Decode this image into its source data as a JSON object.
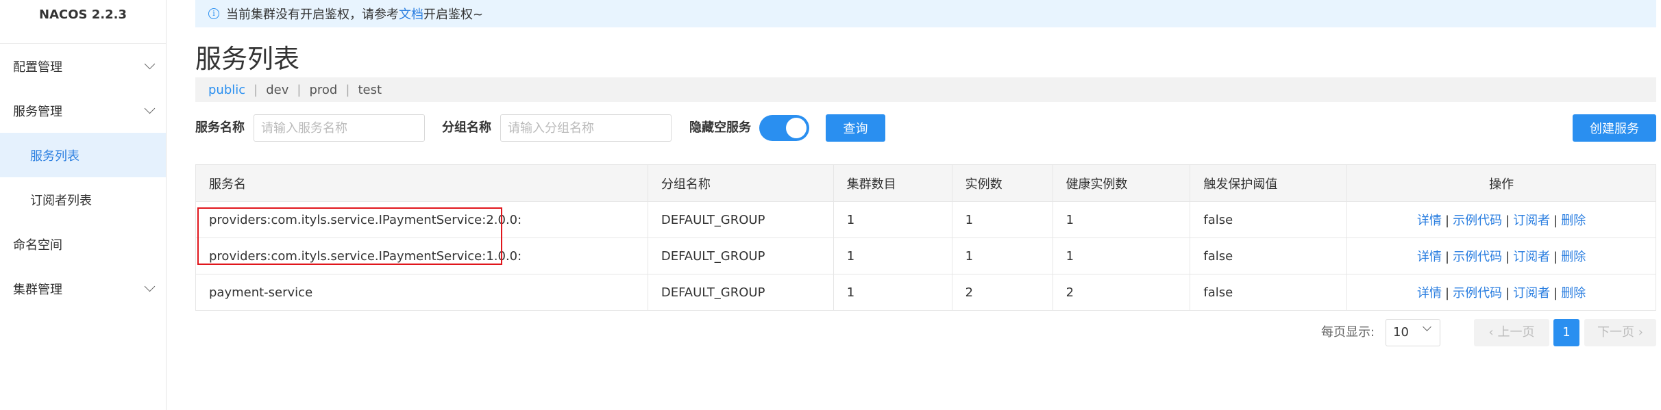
{
  "app": {
    "title": "NACOS 2.2.3"
  },
  "sidebar": {
    "items": [
      {
        "label": "配置管理"
      },
      {
        "label": "服务管理"
      },
      {
        "label": "服务列表"
      },
      {
        "label": "订阅者列表"
      },
      {
        "label": "命名空间"
      },
      {
        "label": "集群管理"
      }
    ]
  },
  "notice": {
    "text": "当前集群没有开启鉴权，请参考",
    "link": "文档",
    "suffix": "开启鉴权~"
  },
  "page": {
    "title": "服务列表"
  },
  "namespaces": [
    "public",
    "dev",
    "prod",
    "test"
  ],
  "filter": {
    "service_label": "服务名称",
    "service_placeholder": "请输入服务名称",
    "group_label": "分组名称",
    "group_placeholder": "请输入分组名称",
    "hide_empty_label": "隐藏空服务",
    "hide_empty_on": true,
    "query_button": "查询",
    "create_button": "创建服务"
  },
  "table": {
    "headers": [
      "服务名",
      "分组名称",
      "集群数目",
      "实例数",
      "健康实例数",
      "触发保护阈值",
      "操作"
    ],
    "rows": [
      {
        "name": "providers:com.ityls.service.IPaymentService:2.0.0:",
        "group": "DEFAULT_GROUP",
        "clusters": "1",
        "instances": "1",
        "healthy": "1",
        "threshold": "false"
      },
      {
        "name": "providers:com.ityls.service.IPaymentService:1.0.0:",
        "group": "DEFAULT_GROUP",
        "clusters": "1",
        "instances": "1",
        "healthy": "1",
        "threshold": "false"
      },
      {
        "name": "payment-service",
        "group": "DEFAULT_GROUP",
        "clusters": "1",
        "instances": "2",
        "healthy": "2",
        "threshold": "false"
      }
    ],
    "ops": {
      "detail": "详情",
      "sample": "示例代码",
      "subscriber": "订阅者",
      "delete": "删除",
      "sep": "|"
    }
  },
  "pagination": {
    "page_size_label": "每页显示:",
    "page_size": "10",
    "prev": "上一页",
    "next": "下一页",
    "current": "1"
  },
  "colors": {
    "primary": "#2a8ff0",
    "notice_bg": "#e8f4fe",
    "active_bg": "#e5f1fd",
    "highlight": "#e0161c"
  }
}
